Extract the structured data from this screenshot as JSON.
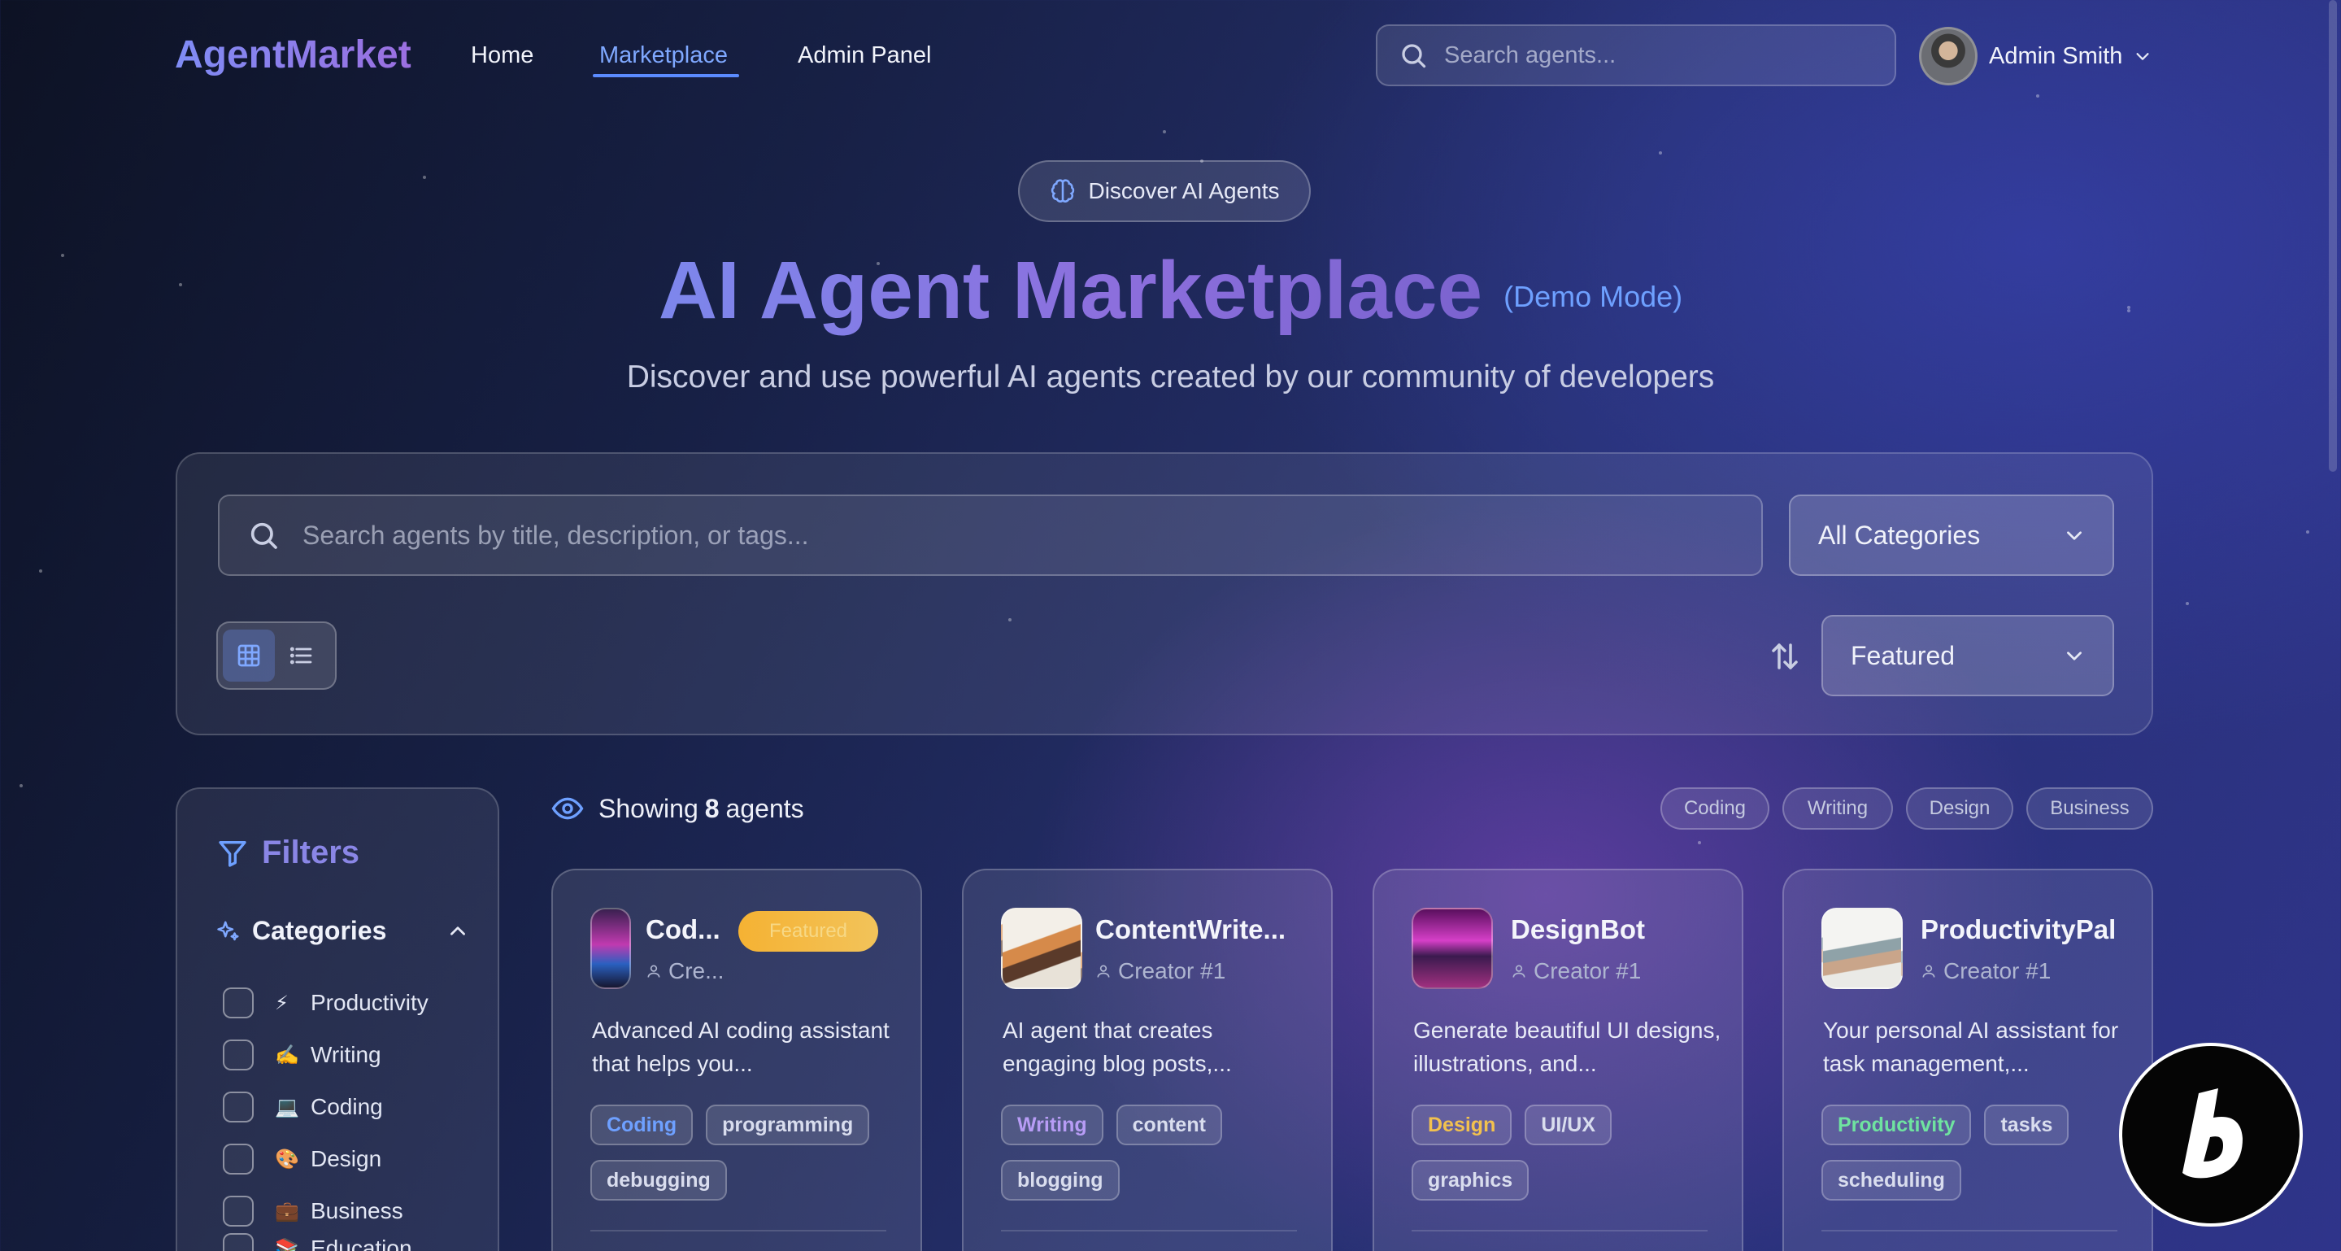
{
  "nav": {
    "logo": "AgentMarket",
    "links": [
      "Home",
      "Marketplace",
      "Admin Panel"
    ],
    "active": "Marketplace",
    "search_placeholder": "Search agents...",
    "user_name": "Admin Smith"
  },
  "hero": {
    "badge": "Discover AI Agents",
    "title": "AI Agent Marketplace",
    "mode": "(Demo Mode)",
    "subtitle": "Discover and use powerful AI agents created by our community of developers"
  },
  "search_panel": {
    "placeholder": "Search agents by title, description, or tags...",
    "category_select": "All Categories",
    "sort_select": "Featured",
    "view_mode": "grid"
  },
  "filters": {
    "title": "Filters",
    "categories_heading": "Categories",
    "categories": [
      {
        "emoji": "⚡",
        "label": "Productivity"
      },
      {
        "emoji": "✍️",
        "label": "Writing"
      },
      {
        "emoji": "💻",
        "label": "Coding"
      },
      {
        "emoji": "🎨",
        "label": "Design"
      },
      {
        "emoji": "💼",
        "label": "Business"
      },
      {
        "emoji": "📚",
        "label": "Education"
      }
    ]
  },
  "results": {
    "showing_prefix": "Showing",
    "count": "8",
    "showing_suffix": "agents",
    "quick_chips": [
      "Coding",
      "Writing",
      "Design",
      "Business"
    ]
  },
  "colors": {
    "accent": "#5b8bff",
    "featured": "#f5b233",
    "coding": "#6ea0ff",
    "writing": "#b79cf5",
    "design": "#f2c14e",
    "productivity": "#6fe3a0"
  },
  "agents": [
    {
      "title": "Cod...",
      "creator": "Cre...",
      "featured_label": "Featured",
      "description": "Advanced AI coding assistant that helps you...",
      "category": "Coding",
      "tags": [
        "programming",
        "debugging"
      ]
    },
    {
      "title": "ContentWrite...",
      "creator": "Creator #1",
      "description": "AI agent that creates engaging blog posts,...",
      "category": "Writing",
      "tags": [
        "content",
        "blogging"
      ]
    },
    {
      "title": "DesignBot",
      "creator": "Creator #1",
      "description": "Generate beautiful UI designs, illustrations, and...",
      "category": "Design",
      "tags": [
        "UI/UX",
        "graphics"
      ]
    },
    {
      "title": "ProductivityPal",
      "creator": "Creator #1",
      "description": "Your personal AI assistant for task management,...",
      "category": "Productivity",
      "tags": [
        "tasks",
        "scheduling"
      ]
    }
  ]
}
